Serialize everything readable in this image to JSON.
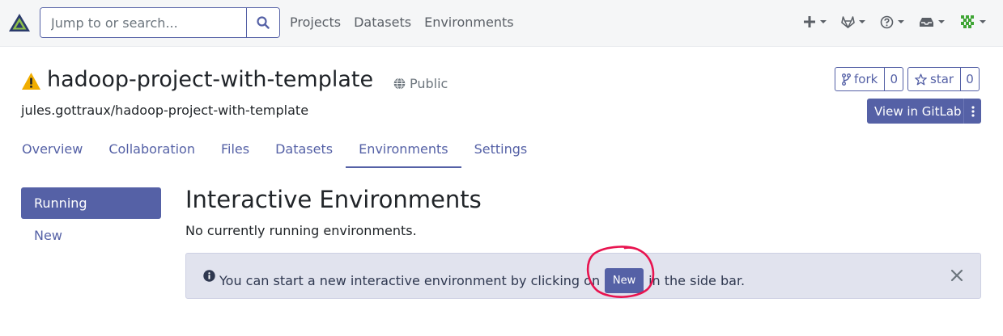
{
  "topnav": {
    "search_placeholder": "Jump to or search...",
    "links": [
      "Projects",
      "Datasets",
      "Environments"
    ],
    "icons": [
      "plus-icon",
      "gitlab-icon",
      "help-icon",
      "inbox-icon",
      "user-avatar"
    ]
  },
  "project": {
    "title": "hadoop-project-with-template",
    "visibility": "Public",
    "path": "jules.gottraux/hadoop-project-with-template",
    "fork_label": "fork",
    "fork_count": "0",
    "star_label": "star",
    "star_count": "0",
    "gitlab_label": "View in GitLab"
  },
  "tabs": [
    "Overview",
    "Collaboration",
    "Files",
    "Datasets",
    "Environments",
    "Settings"
  ],
  "active_tab": "Environments",
  "sidebar": {
    "running": "Running",
    "new": "New"
  },
  "main": {
    "heading": "Interactive Environments",
    "empty_text": "No currently running environments.",
    "alert_before": "You can start a new interactive environment by clicking on",
    "alert_button": "New",
    "alert_after": "in the side bar."
  },
  "colors": {
    "accent": "#5561a6",
    "alert_bg": "#e1e3ee",
    "warning": "#f0ad00",
    "annotation": "#e8134f"
  }
}
